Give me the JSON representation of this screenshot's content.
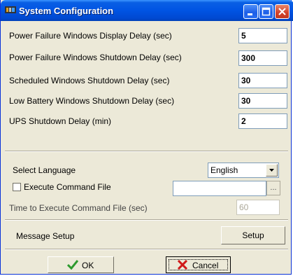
{
  "window": {
    "title": "System Configuration",
    "icon": "ups-app-icon",
    "controls": [
      "minimize-icon",
      "maximize-icon",
      "close-icon"
    ]
  },
  "delays": [
    {
      "label": "Power Failure Windows Display Delay (sec)",
      "value": "5"
    },
    {
      "label": "Power Failure Windows Shutdown Delay (sec)",
      "value": "300"
    },
    {
      "label": "Scheduled Windows Shutdown Delay (sec)",
      "value": "30"
    },
    {
      "label": "Low Battery Windows Shutdown Delay (sec)",
      "value": "30"
    },
    {
      "label": "UPS Shutdown Delay (min)",
      "value": "2"
    }
  ],
  "language": {
    "label": "Select Language",
    "selected": "English"
  },
  "command": {
    "checkbox_label": "Execute Command File",
    "checked": false,
    "file_value": "",
    "browse_label": "...",
    "time_label": "Time to Execute Command File (sec)",
    "time_value": "60"
  },
  "message": {
    "label": "Message Setup",
    "button": "Setup"
  },
  "footer": {
    "ok_label": "OK",
    "cancel_label": "Cancel"
  },
  "colors": {
    "titlebar": "#0054e3",
    "face": "#ece9d8",
    "ok_icon": "#2e9a2e",
    "cancel_icon": "#d01818"
  }
}
